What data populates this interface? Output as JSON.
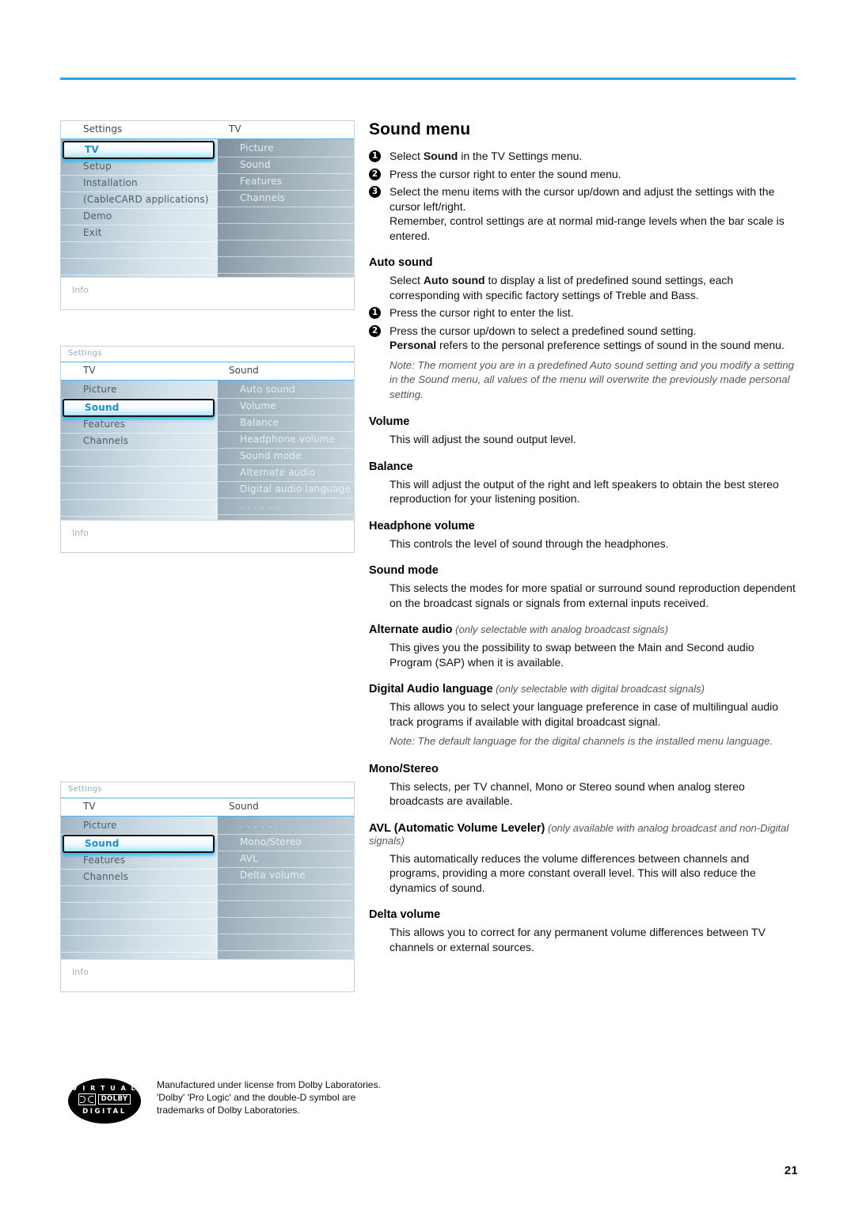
{
  "page": {
    "number": "21",
    "rule_color": "#2aa2f5"
  },
  "osd_menus": [
    {
      "id": "tv-settings",
      "breadcrumb": null,
      "left_header": "Settings",
      "right_header": "TV",
      "left_items": [
        {
          "label": "TV",
          "selected": true
        },
        {
          "label": "Setup",
          "selected": false
        },
        {
          "label": "Installation",
          "selected": false
        },
        {
          "label": "(CableCARD applications)",
          "selected": false
        },
        {
          "label": "Demo",
          "selected": false
        },
        {
          "label": "Exit",
          "selected": false
        },
        {
          "label": "",
          "selected": false
        },
        {
          "label": "",
          "selected": false
        },
        {
          "label": "",
          "selected": false
        }
      ],
      "right_items": [
        {
          "label": "Picture"
        },
        {
          "label": "Sound"
        },
        {
          "label": "Features"
        },
        {
          "label": "Channels"
        },
        {
          "label": ""
        },
        {
          "label": ""
        },
        {
          "label": ""
        },
        {
          "label": ""
        },
        {
          "label": ""
        }
      ],
      "info_label": "Info"
    },
    {
      "id": "sound-menu-top",
      "breadcrumb": "Settings",
      "left_header": "TV",
      "right_header": "Sound",
      "left_items": [
        {
          "label": "Picture",
          "selected": false
        },
        {
          "label": "Sound",
          "selected": true
        },
        {
          "label": "Features",
          "selected": false
        },
        {
          "label": "Channels",
          "selected": false
        },
        {
          "label": "",
          "selected": false
        },
        {
          "label": "",
          "selected": false
        },
        {
          "label": "",
          "selected": false
        },
        {
          "label": "",
          "selected": false
        }
      ],
      "right_items": [
        {
          "label": "Auto sound"
        },
        {
          "label": "Volume"
        },
        {
          "label": "Balance"
        },
        {
          "label": "Headphone volume"
        },
        {
          "label": "Sound mode"
        },
        {
          "label": "Alternate audio"
        },
        {
          "label": "Digital audio language"
        },
        {
          "label": ". . . . . .",
          "dots": true
        }
      ],
      "info_label": "Info"
    },
    {
      "id": "sound-menu-bottom",
      "breadcrumb": "Settings",
      "left_header": "TV",
      "right_header": "Sound",
      "left_items": [
        {
          "label": "Picture",
          "selected": false
        },
        {
          "label": "Sound",
          "selected": true
        },
        {
          "label": "Features",
          "selected": false
        },
        {
          "label": "Channels",
          "selected": false
        },
        {
          "label": "",
          "selected": false
        },
        {
          "label": "",
          "selected": false
        },
        {
          "label": "",
          "selected": false
        },
        {
          "label": "",
          "selected": false
        }
      ],
      "right_items": [
        {
          "label": ". . . . . .",
          "dots": true
        },
        {
          "label": "Mono/Stereo"
        },
        {
          "label": "AVL"
        },
        {
          "label": "Delta volume"
        },
        {
          "label": ""
        },
        {
          "label": ""
        },
        {
          "label": ""
        },
        {
          "label": ""
        }
      ],
      "info_label": "Info"
    }
  ],
  "article": {
    "title": "Sound menu",
    "steps_intro": [
      {
        "num": "1",
        "html": "Select <b>Sound</b> in the TV Settings menu."
      },
      {
        "num": "2",
        "html": "Press the cursor right to enter the sound menu."
      },
      {
        "num": "3",
        "html": "Select the menu items with the cursor up/down and adjust the settings with the cursor left/right.<br>Remember, control settings are at normal mid-range levels when the bar scale is entered."
      }
    ],
    "sections": [
      {
        "heading": "Auto sound",
        "qualifier": "",
        "body": "Select <b>Auto sound</b> to display a list of predefined sound settings, each corresponding with specific factory settings of Treble and Bass.",
        "steps": [
          {
            "num": "1",
            "html": "Press the cursor right to enter the list."
          },
          {
            "num": "2",
            "html": "Press the cursor up/down to select a predefined sound setting.<br><b>Personal</b> refers to the personal preference settings of sound in the sound menu."
          }
        ],
        "note": "Note: The moment you are in a predefined Auto sound setting and you modify a setting in the Sound menu, all values of the menu will overwrite the previously made personal setting."
      },
      {
        "heading": "Volume",
        "qualifier": "",
        "body": "This will adjust the sound output level.",
        "steps": [],
        "note": ""
      },
      {
        "heading": "Balance",
        "qualifier": "",
        "body": "This will adjust the output of the right and left speakers to obtain the best stereo reproduction for your listening position.",
        "steps": [],
        "note": ""
      },
      {
        "heading": "Headphone volume",
        "qualifier": "",
        "body": "This controls the level of sound through the headphones.",
        "steps": [],
        "note": ""
      },
      {
        "heading": "Sound mode",
        "qualifier": "",
        "body": "This selects the modes for more spatial or surround sound reproduction dependent on the broadcast signals or signals from external inputs received.",
        "steps": [],
        "note": ""
      },
      {
        "heading": "Alternate audio",
        "qualifier": "(only selectable with analog broadcast signals)",
        "body": "This gives you the possibility to swap between the Main and Second audio Program (SAP) when it is available.",
        "steps": [],
        "note": ""
      },
      {
        "heading": "Digital Audio language",
        "qualifier": "(only selectable with digital broadcast signals)",
        "body": "This allows you to select your language preference in case of multilingual audio track programs if available with digital broadcast signal.",
        "steps": [],
        "note": "Note: The default language for the digital channels is the installed menu language."
      },
      {
        "heading": "Mono/Stereo",
        "qualifier": "",
        "body": "This selects, per TV channel, Mono or Stereo sound when analog stereo broadcasts are available.",
        "steps": [],
        "note": ""
      },
      {
        "heading": "AVL (Automatic Volume Leveler)",
        "qualifier": "(only available with analog broadcast and non-Digital signals)",
        "body": "This automatically reduces the volume differences between channels and programs, providing a more constant overall level. This will also reduce the dynamics of sound.",
        "steps": [],
        "note": ""
      },
      {
        "heading": "Delta volume",
        "qualifier": "",
        "body": "This allows you to correct for any permanent volume differences between TV channels or external sources.",
        "steps": [],
        "note": ""
      }
    ]
  },
  "footer": {
    "logo": {
      "top_text": "V I R T U A L",
      "word": "DOLBY",
      "bottom_text": "DIGITAL"
    },
    "text": "Manufactured under license from Dolby Laboratories.<br>'Dolby' 'Pro Logic' and the double-D symbol are<br>trademarks of Dolby Laboratories."
  }
}
